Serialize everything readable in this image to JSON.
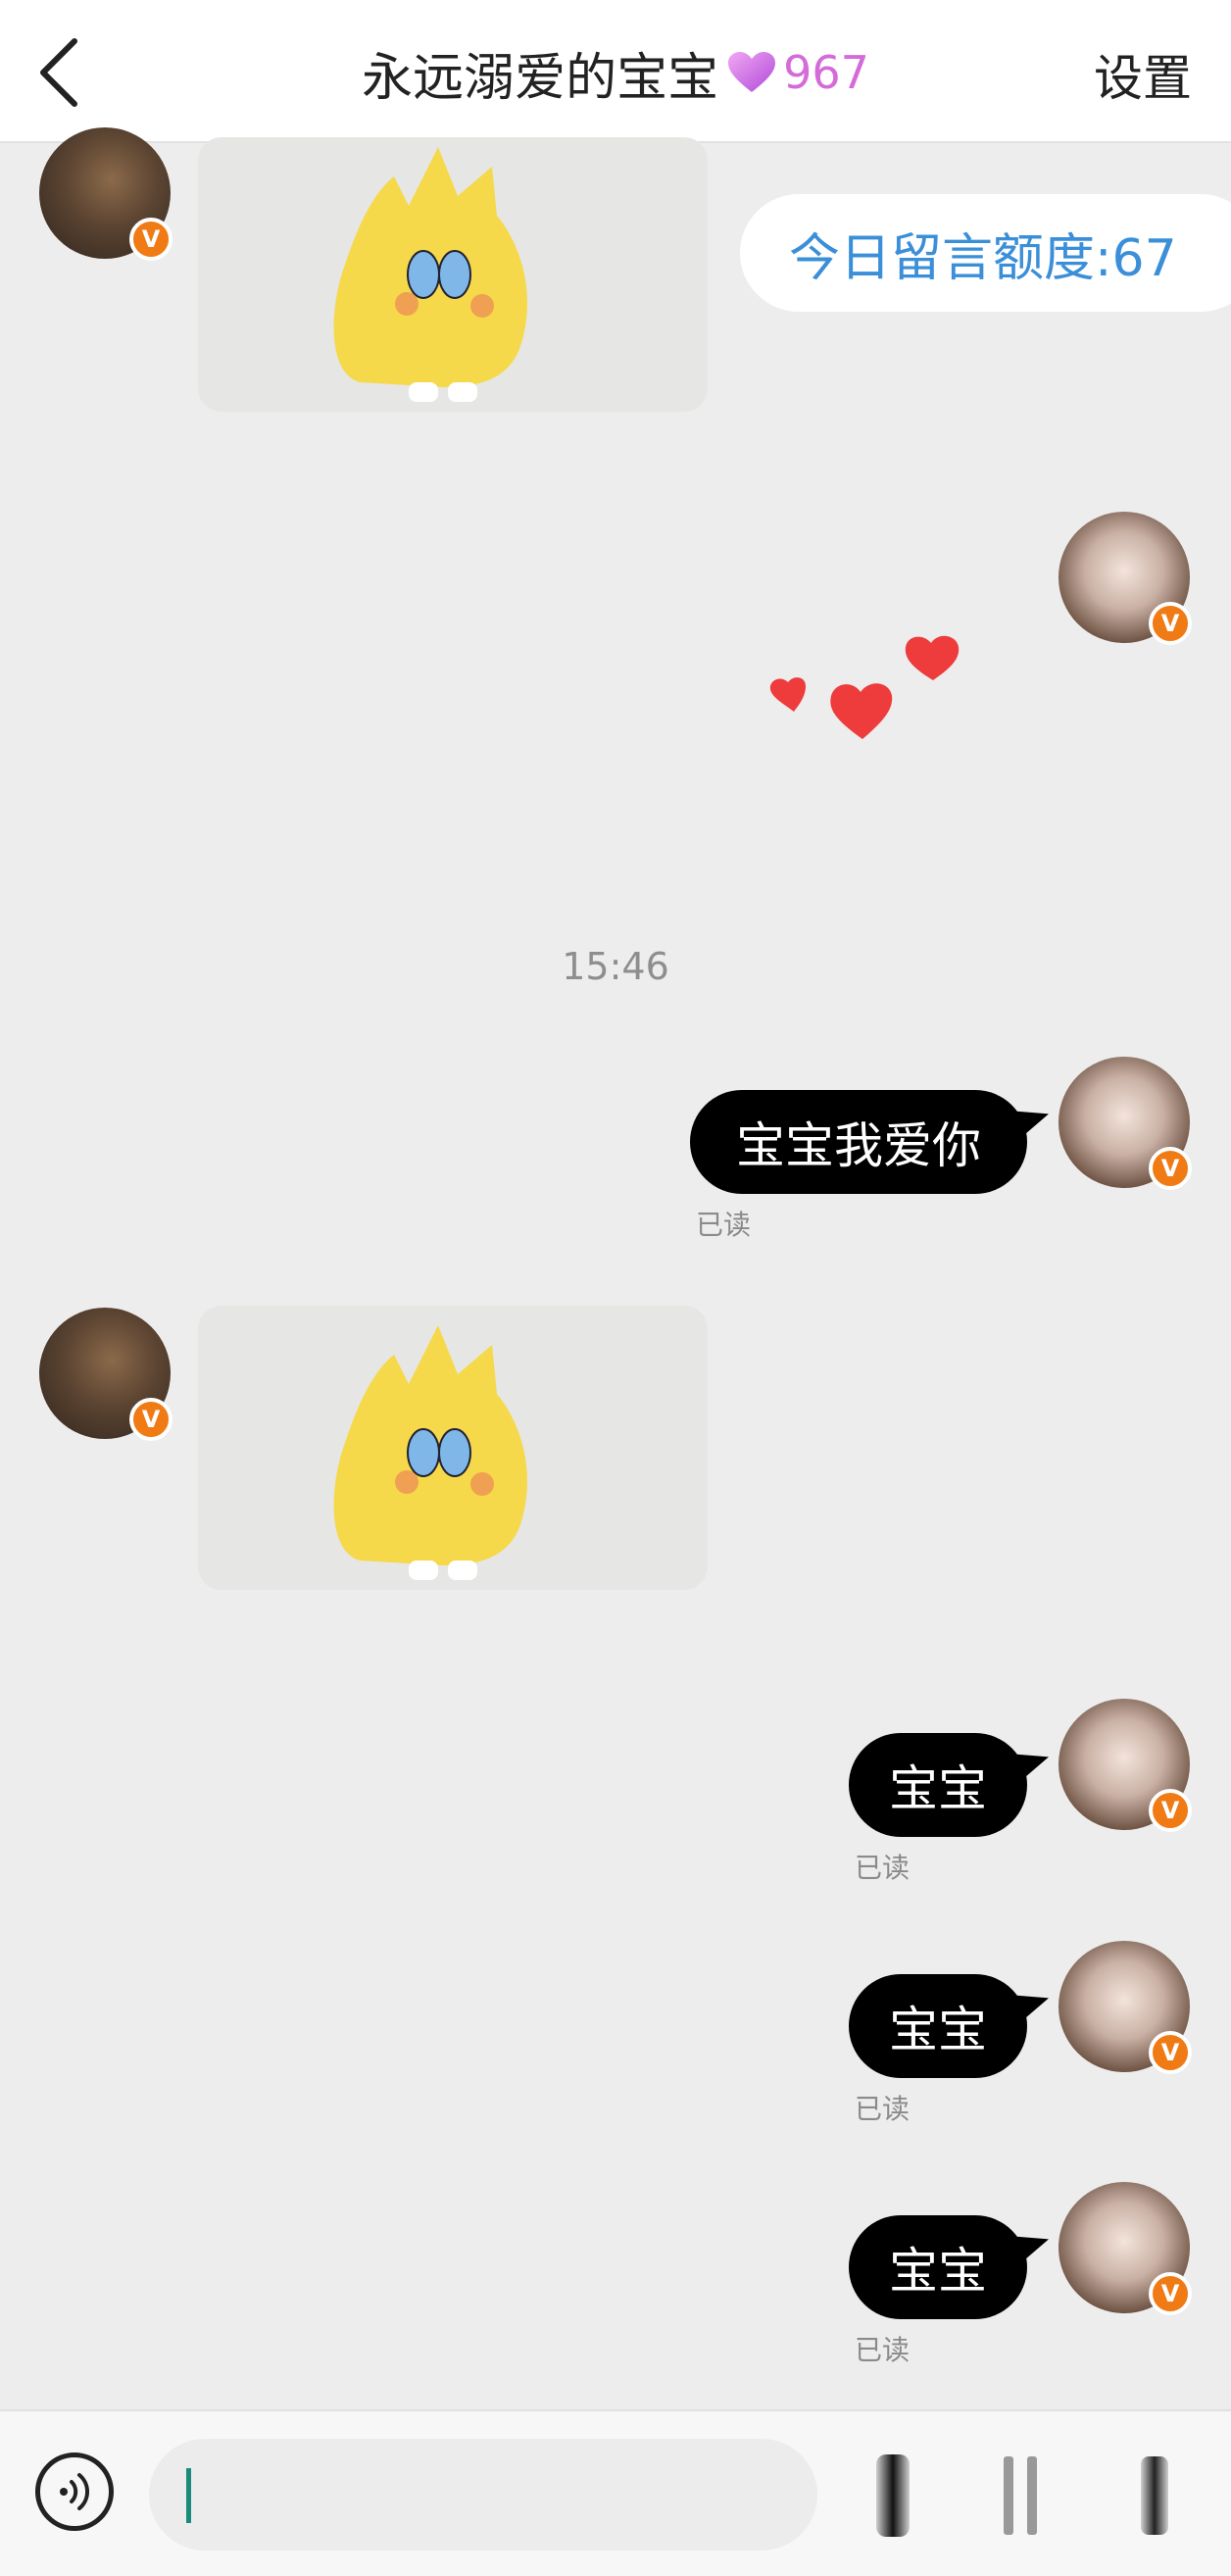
{
  "header": {
    "title": "永远溺爱的宝宝",
    "intimacy": "967",
    "settings_label": "设置"
  },
  "quota_text": "今日留言额度:67",
  "timestamp": "15:46",
  "messages": [
    {
      "from": "friend",
      "type": "sticker"
    },
    {
      "from": "me",
      "type": "hearts"
    },
    {
      "from": "me",
      "type": "text",
      "text": "宝宝我爱你",
      "status": "已读"
    },
    {
      "from": "friend",
      "type": "sticker"
    },
    {
      "from": "me",
      "type": "text",
      "text": "宝宝",
      "status": "已读"
    },
    {
      "from": "me",
      "type": "text",
      "text": "宝宝",
      "status": "已读"
    },
    {
      "from": "me",
      "type": "text",
      "text": "宝宝",
      "status": "已读"
    }
  ],
  "badge_letter": "V",
  "icons": [
    "back-arrow-icon",
    "heart-gem-icon",
    "verified-badge-icon",
    "voice-icon",
    "sticker-icon",
    "more-icon"
  ],
  "colors": {
    "accent_blue": "#3a8fd8",
    "intimacy_purple": "#d46bd9",
    "badge_orange": "#f07a14"
  }
}
